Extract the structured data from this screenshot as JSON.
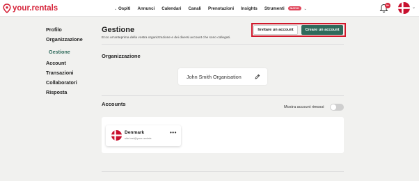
{
  "brand": {
    "logo_text": "your.rentals"
  },
  "nav": {
    "items": [
      {
        "label": "Ospiti",
        "has_dropdown": true
      },
      {
        "label": "Annunci"
      },
      {
        "label": "Calendari"
      },
      {
        "label": "Canali"
      },
      {
        "label": "Prenotazioni"
      },
      {
        "label": "Insights"
      },
      {
        "label": "Strumenti",
        "badge": "NUOVO",
        "has_dropdown": true
      }
    ],
    "notification_count": "9+"
  },
  "sidebar": {
    "items": [
      {
        "label": "Profilo"
      },
      {
        "label": "Organizzazione"
      },
      {
        "label": "Gestione",
        "active": true
      },
      {
        "label": "Account"
      },
      {
        "label": "Transazioni"
      },
      {
        "label": "Collaboratori"
      },
      {
        "label": "Risposta"
      }
    ]
  },
  "main": {
    "title": "Gestione",
    "subtitle": "Ecco un'anteprima della vostra organizzazione e dei diversi account che sono collegati.",
    "invite_button": "Invitare un account",
    "create_button": "Creare un account",
    "organization_section": {
      "title": "Organizzazione",
      "org_name": "John Smith Organisation"
    },
    "accounts_section": {
      "title": "Accounts",
      "toggle_label": "Mostra account rimossi",
      "toggle_on": false,
      "accounts": [
        {
          "name": "Denmark",
          "email": "site.test@your.rentals",
          "flag": "denmark"
        }
      ]
    }
  },
  "colors": {
    "brand_red": "#d6253b",
    "primary_green": "#2f6a5b",
    "highlight_red": "#d1182b",
    "background": "#f1f1ef"
  }
}
